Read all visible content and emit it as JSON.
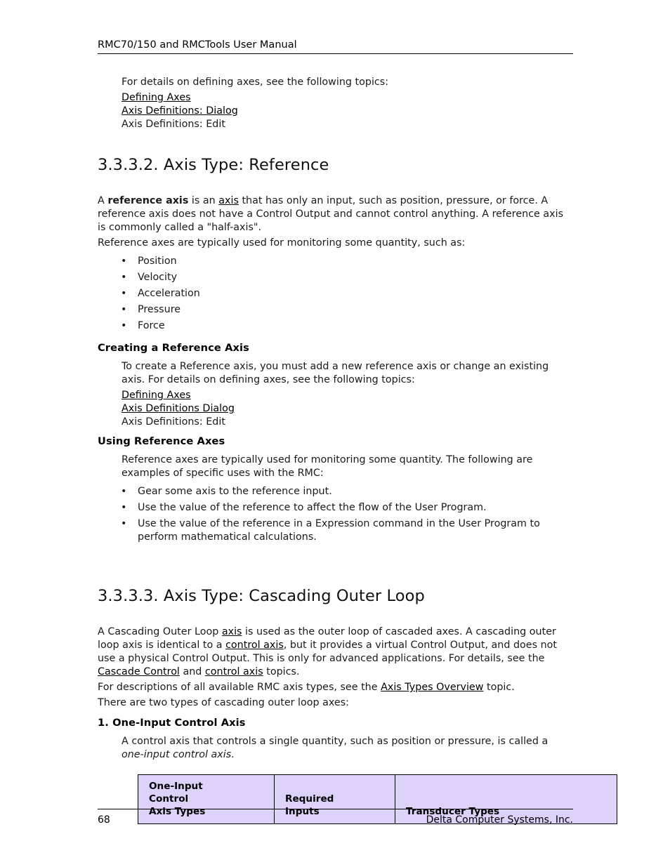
{
  "document": {
    "running_header": "RMC70/150 and RMCTools User Manual",
    "footer": {
      "page_number": "68",
      "company": "Delta Computer Systems, Inc."
    }
  },
  "intro": {
    "lead": "For details on defining axes, see the following topics:",
    "links": [
      "Defining Axes",
      "Axis Definitions: Dialog"
    ],
    "plain": "Axis Definitions: Edit"
  },
  "section_reference": {
    "heading": "3.3.3.2. Axis Type: Reference",
    "para1": {
      "t1": "A ",
      "bold1": "reference axis",
      "t2": " is an ",
      "link1": "axis",
      "t3": " that has only an input, such as position, pressure, or force. A reference axis does not have a Control Output and cannot control anything. A reference axis is commonly called a \"half-axis\"."
    },
    "para2": "Reference axes are typically used for monitoring some quantity, such as:",
    "bullets": [
      "Position",
      "Velocity",
      "Acceleration",
      "Pressure",
      "Force"
    ],
    "creating": {
      "heading": "Creating a Reference Axis",
      "para": "To create a Reference axis, you must add a new reference axis or change an existing axis. For details on defining axes, see the following topics:",
      "links": [
        "Defining Axes",
        "Axis Definitions Dialog"
      ],
      "plain": "Axis Definitions: Edit"
    },
    "using": {
      "heading": "Using Reference Axes",
      "para": "Reference axes are typically used for monitoring some quantity. The following are examples of specific uses with the RMC:",
      "bullets": [
        "Gear some axis to the reference input.",
        "Use the value of the reference to affect the flow of the User Program.",
        "Use the value of the reference in a Expression command in the User Program to perform mathematical calculations."
      ]
    }
  },
  "section_cascading": {
    "heading": "3.3.3.3. Axis Type: Cascading Outer Loop",
    "para1": {
      "t1": "A Cascading Outer Loop ",
      "link1": "axis",
      "t2": " is used as the outer loop of cascaded axes. A cascading outer loop axis is identical to a ",
      "link2": "control axis",
      "t3": ", but it provides a virtual Control Output, and does not use a physical Control Output. This is only for advanced applications. For details, see the ",
      "link3": "Cascade Control",
      "t4": " and ",
      "link4": "control axis",
      "t5": " topics."
    },
    "para2": {
      "t1": "For descriptions of all available RMC axis types, see the ",
      "link1": "Axis Types Overview",
      "t2": " topic."
    },
    "para3": "There are two types of cascading outer loop axes:",
    "one_input": {
      "heading": "1. One-Input Control Axis",
      "para": {
        "t1": "A control axis that controls a single quantity, such as position or pressure, is called a ",
        "italic1": "one-input control axis",
        "t2": "."
      }
    },
    "table": {
      "header_col1_line1": "One-Input",
      "header_col1_line2": "Control",
      "header_col1_line3": "Axis Types",
      "header_col2_line1": "Required",
      "header_col2_line2": "Inputs",
      "header_col3": "Transducer Types",
      "accent_color": "#ded1fa"
    }
  }
}
